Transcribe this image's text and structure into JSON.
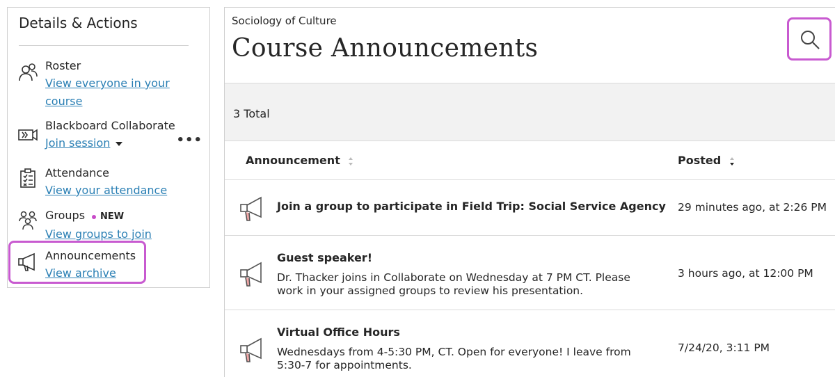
{
  "sidebar": {
    "title": "Details & Actions",
    "items": [
      {
        "icon": "roster-icon",
        "label": "Roster",
        "link_line1": "View everyone in your",
        "link_line2": "course"
      },
      {
        "icon": "collaborate-icon",
        "label": "Blackboard Collaborate",
        "link": "Join session",
        "more": "•••"
      },
      {
        "icon": "attendance-icon",
        "label": "Attendance",
        "link": "View your attendance"
      },
      {
        "icon": "groups-icon",
        "label": "Groups",
        "badge": "NEW",
        "link": "View groups to join"
      },
      {
        "icon": "megaphone-icon",
        "label": "Announcements",
        "link": "View archive"
      }
    ]
  },
  "main": {
    "course_name": "Sociology of Culture",
    "title": "Course Announcements",
    "search_icon": "search-icon",
    "total": "3 Total",
    "columns": {
      "announcement": "Announcement",
      "posted": "Posted"
    },
    "announcements": [
      {
        "title": "Join a group to participate in Field Trip: Social Service Agency",
        "body_line1": "",
        "body_line2": "",
        "posted": "29 minutes ago, at 2:26 PM"
      },
      {
        "title": "Guest speaker!",
        "body_line1": "Dr. Thacker joins in Collaborate on Wednesday at 7 PM CT. Please",
        "body_line2": "work in your assigned groups to review his presentation.",
        "posted": "3 hours ago, at 12:00 PM"
      },
      {
        "title": "Virtual Office Hours",
        "body_line1": "Wednesdays from 4-5:30 PM, CT. Open for everyone! I leave from",
        "body_line2": "5:30-7 for appointments.",
        "posted": "7/24/20, 3:11 PM"
      }
    ]
  },
  "colors": {
    "link": "#2a7fb4",
    "highlight": "#c85ad0",
    "icon_accent": "#f0a7a7"
  }
}
